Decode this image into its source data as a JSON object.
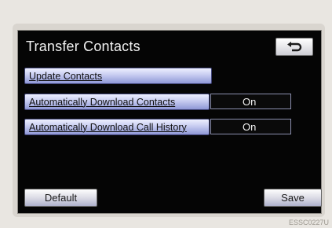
{
  "screen": {
    "title": "Transfer Contacts"
  },
  "back": {
    "icon": "return-arrow-icon"
  },
  "options": [
    {
      "label": "Update Contacts",
      "status": null
    },
    {
      "label": "Automatically Download Contacts",
      "status": "On"
    },
    {
      "label": "Automatically Download Call History",
      "status": "On"
    }
  ],
  "footer": {
    "default_label": "Default",
    "save_label": "Save"
  },
  "image_code": "ESSC0227U",
  "colors": {
    "screen_bg": "#050505",
    "button_blue": "#c6cbf0",
    "text_light": "#f2f2f2"
  }
}
